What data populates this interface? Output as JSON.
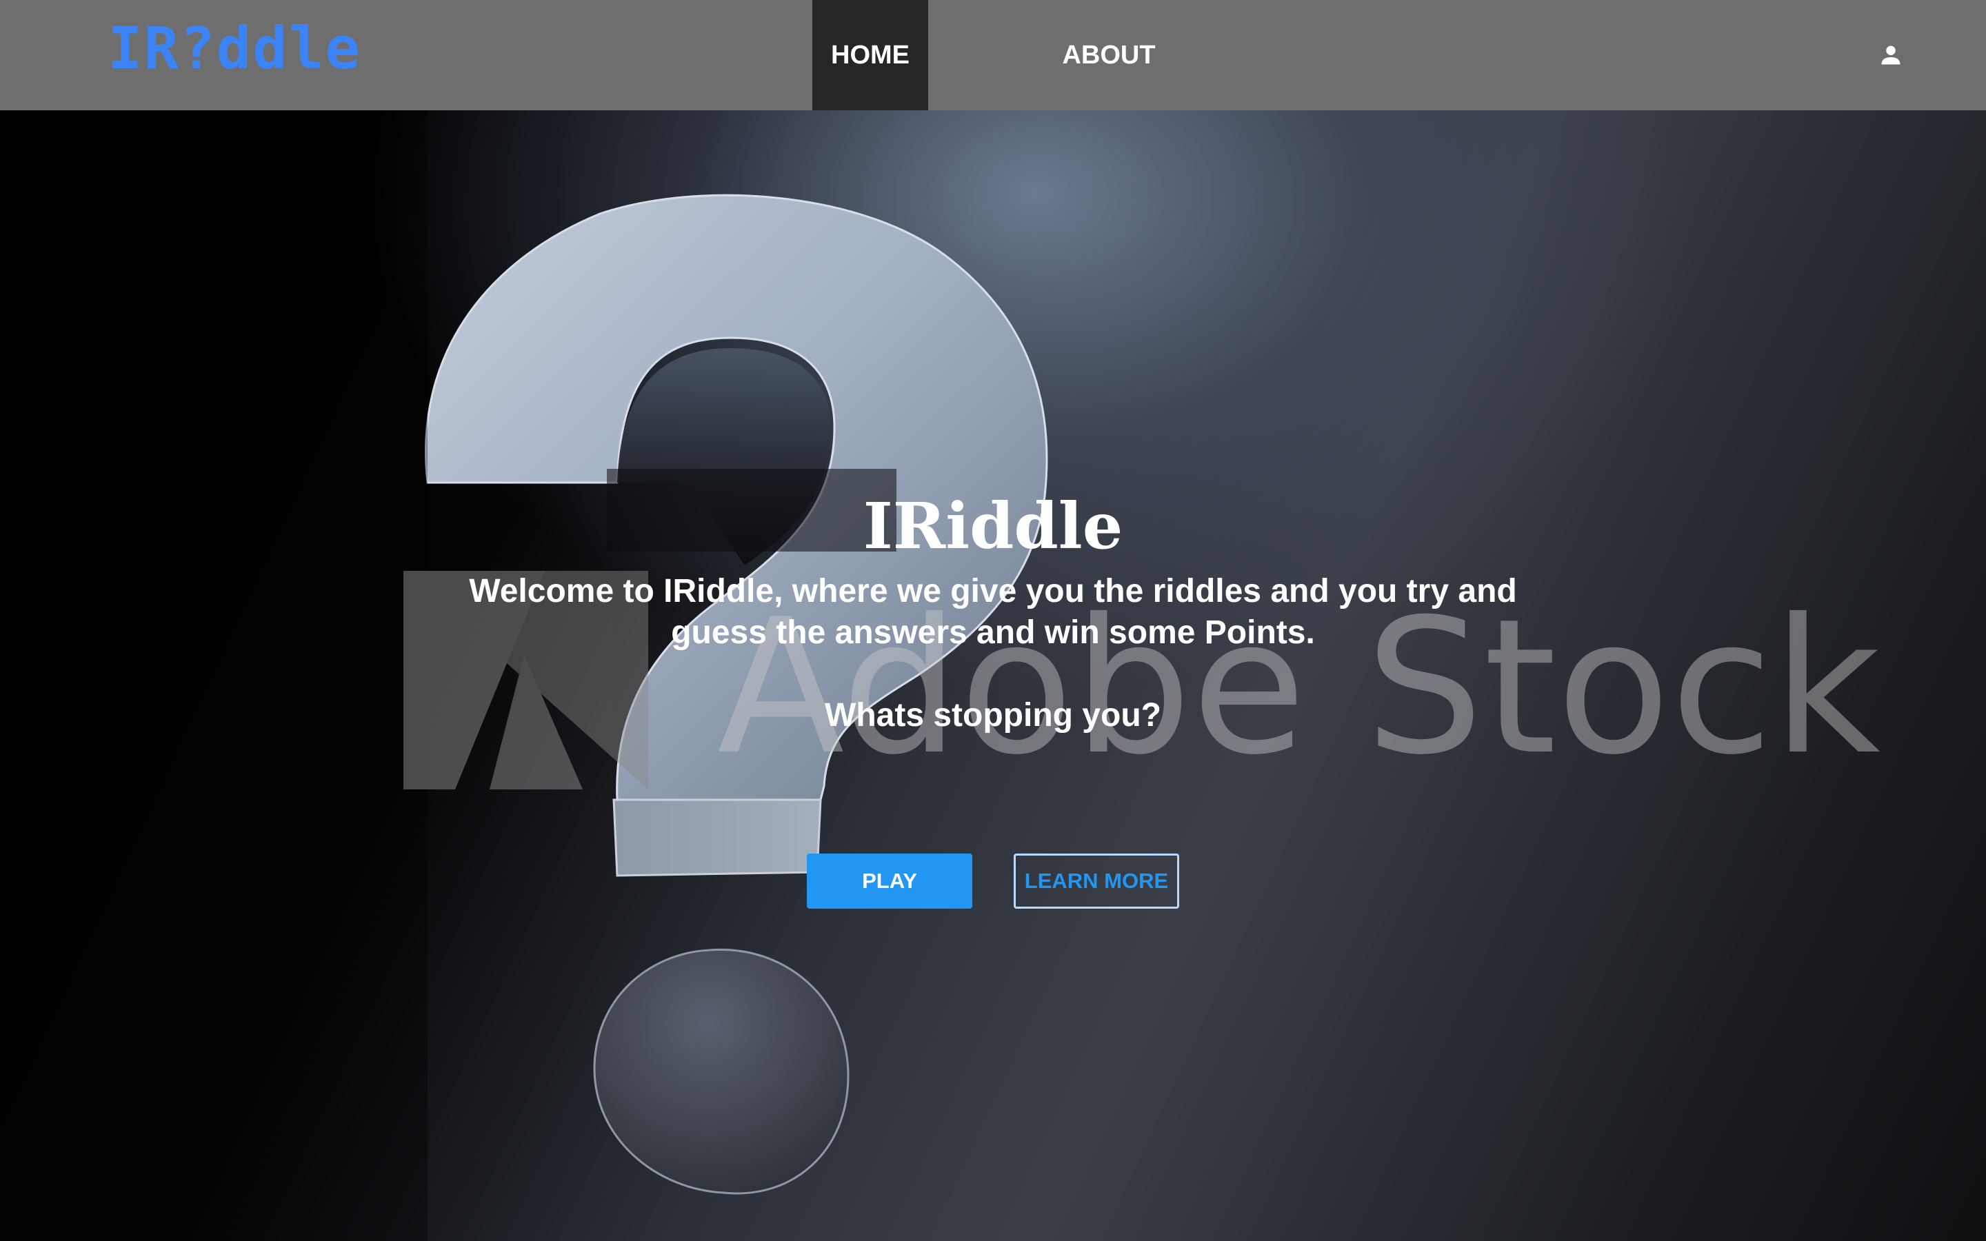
{
  "navbar": {
    "logo_text": {
      "prefix": "IR",
      "mark": "?",
      "suffix": "ddle"
    },
    "links": [
      {
        "label": "HOME",
        "active": true
      },
      {
        "label": "ABOUT",
        "active": false
      }
    ],
    "user_icon": "person-icon"
  },
  "hero": {
    "title": "IRiddle",
    "welcome_text": "Welcome to IRiddle, where we give you the riddles and you try and guess the answers and win some Points.",
    "question_text": "Whats stopping you?",
    "play_label": "PLAY",
    "learn_more_label": "LEARN MORE",
    "watermark_text": "Adobe Stock"
  },
  "colors": {
    "navbar_bg": "#6e6e6e",
    "nav_active_bg": "#262626",
    "logo": "#3c84f5",
    "primary": "#2196f3",
    "outline": "#b6d9ff"
  }
}
